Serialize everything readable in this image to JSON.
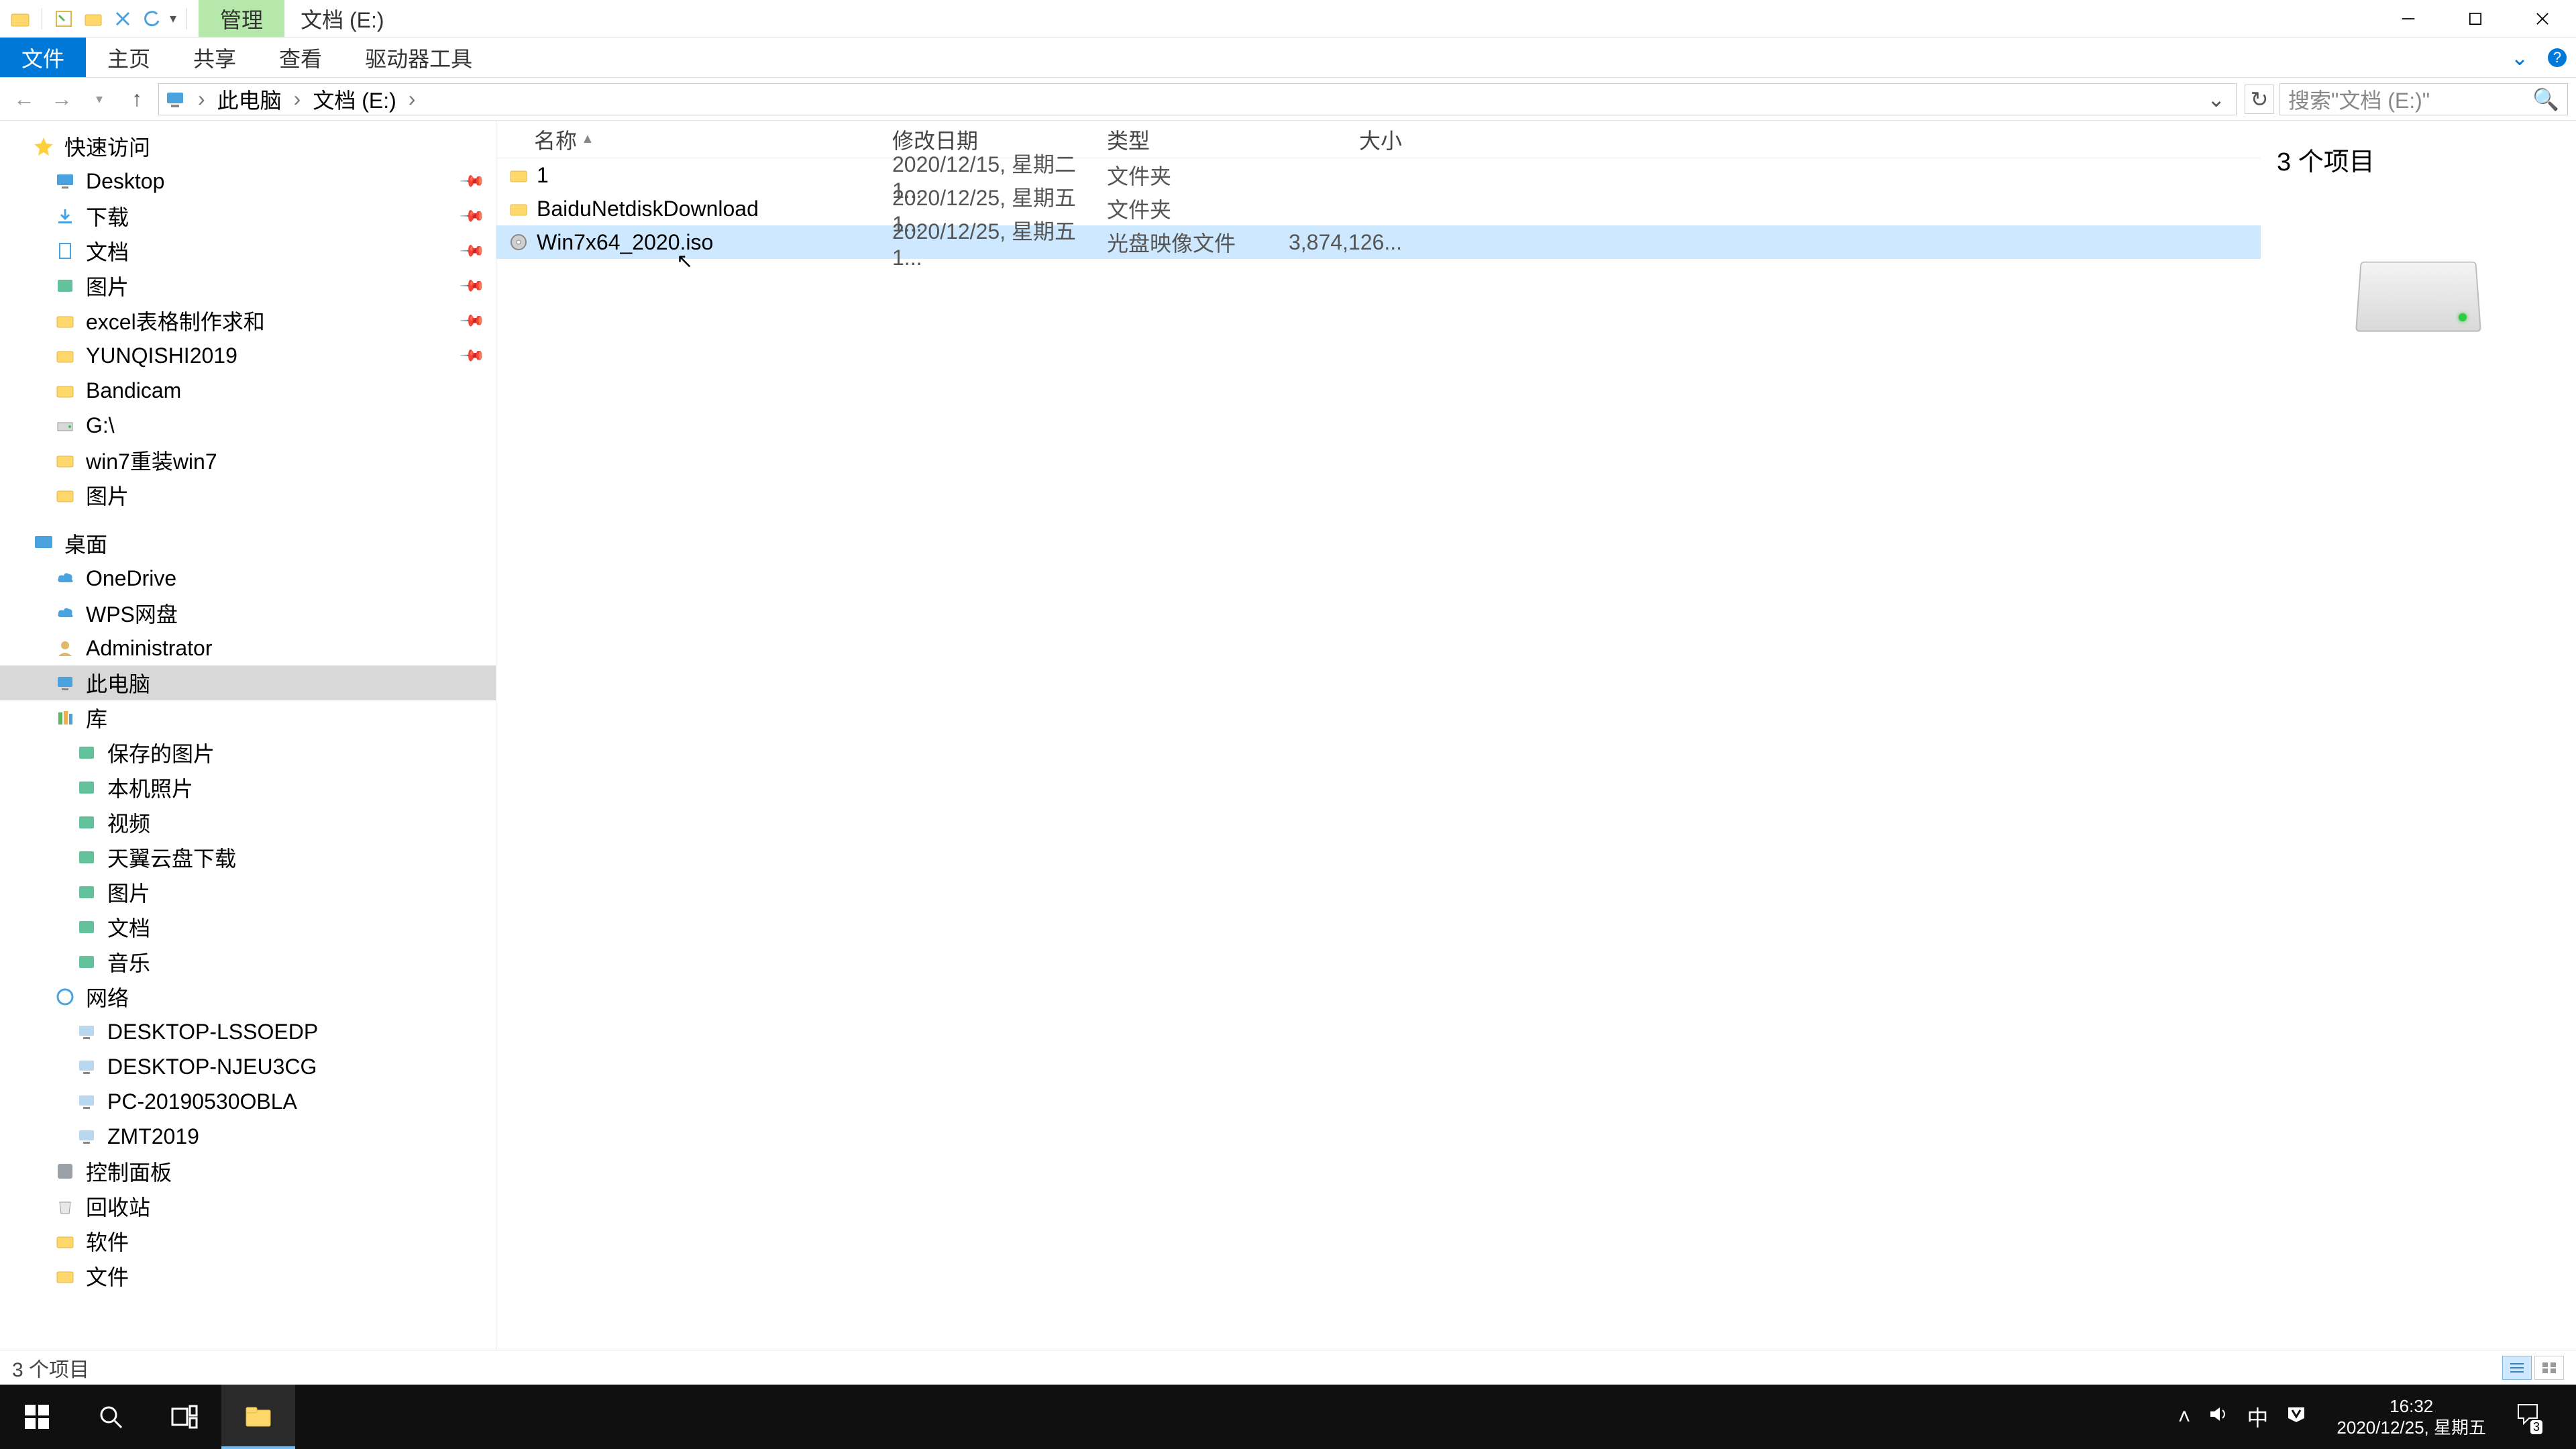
{
  "title_context_tab": "管理",
  "title_location": "文档 (E:)",
  "ribbon": {
    "file": "文件",
    "home": "主页",
    "share": "共享",
    "view": "查看",
    "drive_tools": "驱动器工具"
  },
  "breadcrumb": {
    "pc": "此电脑",
    "drive": "文档 (E:)"
  },
  "search": {
    "placeholder": "搜索\"文档 (E:)\""
  },
  "sidebar": {
    "quick_access": "快速访问",
    "qa_items": [
      {
        "label": "Desktop",
        "icon": "desktop"
      },
      {
        "label": "下载",
        "icon": "download"
      },
      {
        "label": "文档",
        "icon": "doc"
      },
      {
        "label": "图片",
        "icon": "pic"
      },
      {
        "label": "excel表格制作求和",
        "icon": "folder"
      },
      {
        "label": "YUNQISHI2019",
        "icon": "folder-blue"
      },
      {
        "label": "Bandicam",
        "icon": "folder"
      },
      {
        "label": "G:\\",
        "icon": "drive"
      },
      {
        "label": "win7重装win7",
        "icon": "folder"
      },
      {
        "label": "图片",
        "icon": "folder"
      }
    ],
    "desktop": "桌面",
    "desktop_items": [
      {
        "label": "OneDrive",
        "icon": "cloud"
      },
      {
        "label": "WPS网盘",
        "icon": "cloud"
      },
      {
        "label": "Administrator",
        "icon": "user"
      },
      {
        "label": "此电脑",
        "icon": "pc",
        "selected": true
      },
      {
        "label": "库",
        "icon": "lib"
      }
    ],
    "lib_items": [
      {
        "label": "保存的图片"
      },
      {
        "label": "本机照片"
      },
      {
        "label": "视频"
      },
      {
        "label": "天翼云盘下载"
      },
      {
        "label": "图片"
      },
      {
        "label": "文档"
      },
      {
        "label": "音乐"
      }
    ],
    "network": "网络",
    "net_items": [
      {
        "label": "DESKTOP-LSSOEDP"
      },
      {
        "label": "DESKTOP-NJEU3CG"
      },
      {
        "label": "PC-20190530OBLA"
      },
      {
        "label": "ZMT2019"
      }
    ],
    "control_panel": "控制面板",
    "recycle": "回收站",
    "software": "软件",
    "wenjian": "文件"
  },
  "columns": {
    "name": "名称",
    "date": "修改日期",
    "type": "类型",
    "size": "大小"
  },
  "rows": [
    {
      "name": "1",
      "date": "2020/12/15, 星期二 1...",
      "type": "文件夹",
      "size": "",
      "icon": "folder"
    },
    {
      "name": "BaiduNetdiskDownload",
      "date": "2020/12/25, 星期五 1...",
      "type": "文件夹",
      "size": "",
      "icon": "folder"
    },
    {
      "name": "Win7x64_2020.iso",
      "date": "2020/12/25, 星期五 1...",
      "type": "光盘映像文件",
      "size": "3,874,126...",
      "icon": "disc",
      "selected": true
    }
  ],
  "preview": {
    "title": "3 个项目"
  },
  "statusbar": {
    "text": "3 个项目"
  },
  "taskbar": {
    "time": "16:32",
    "date": "2020/12/25, 星期五",
    "ime": "中",
    "notif_count": "3"
  }
}
